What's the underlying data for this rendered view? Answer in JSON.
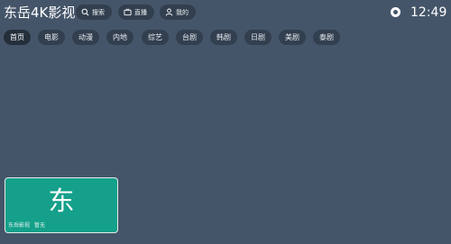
{
  "header": {
    "app_title": "东岳4K影视",
    "search_label": "搜索",
    "live_label": "直播",
    "mine_label": "我的",
    "time": "12:49"
  },
  "tabs": [
    {
      "label": "首页",
      "active": true
    },
    {
      "label": "电影",
      "active": false
    },
    {
      "label": "动漫",
      "active": false
    },
    {
      "label": "内地",
      "active": false
    },
    {
      "label": "综艺",
      "active": false
    },
    {
      "label": "台剧",
      "active": false
    },
    {
      "label": "韩剧",
      "active": false
    },
    {
      "label": "日剧",
      "active": false
    },
    {
      "label": "美剧",
      "active": false
    },
    {
      "label": "泰剧",
      "active": false
    }
  ],
  "card": {
    "glyph": "东",
    "name": "东岳影视",
    "status": "暂无"
  },
  "colors": {
    "background": "#455569",
    "chip": "#323f4f",
    "chip_active": "#252f3c",
    "card": "#14a08a"
  },
  "icons": {
    "search": "search-icon",
    "live": "tv-icon",
    "mine": "user-icon",
    "settings": "settings-icon"
  }
}
